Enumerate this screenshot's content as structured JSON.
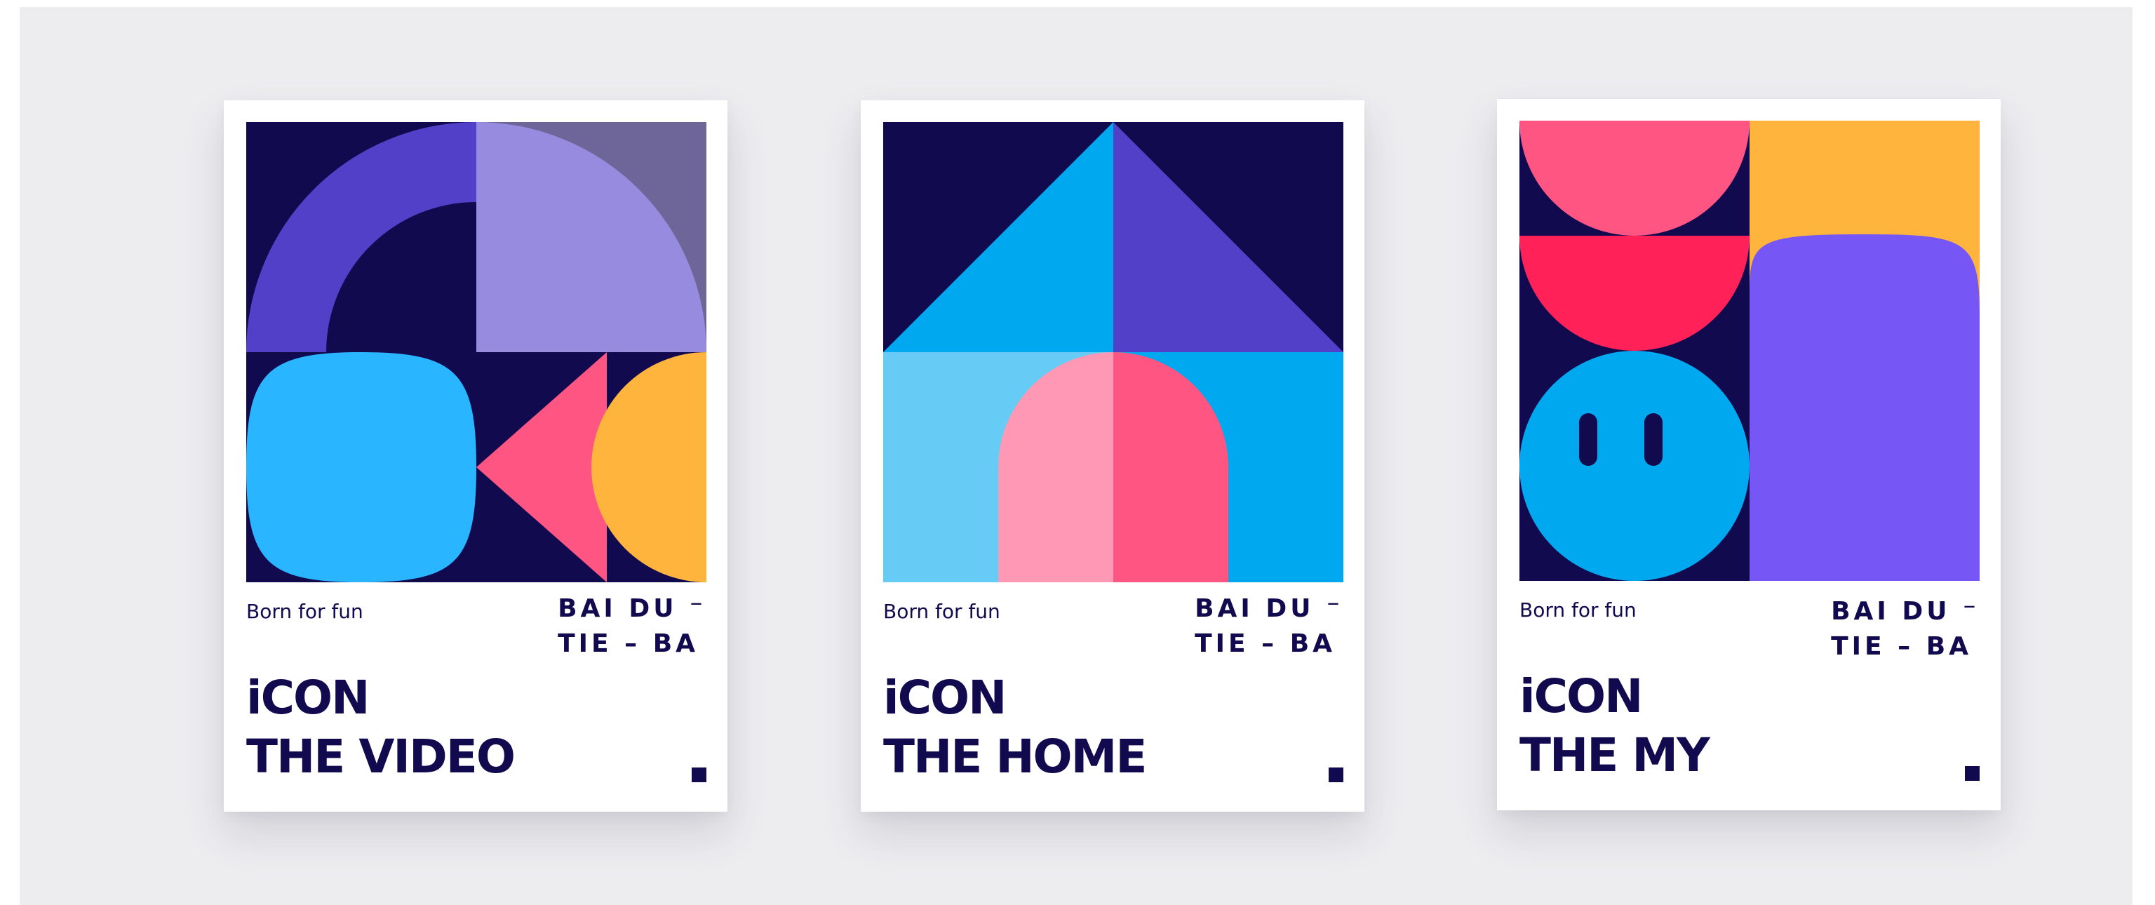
{
  "posters": [
    {
      "name": "video",
      "tagline": "Born for fun",
      "brand_line1": "BAI DU ⁻",
      "brand_line2": "TIE – BA",
      "title_line1": "iCON",
      "title_line2": "THE VIDEO"
    },
    {
      "name": "home",
      "tagline": "Born for fun",
      "brand_line1": "BAI DU ⁻",
      "brand_line2": "TIE – BA",
      "title_line1": "iCON",
      "title_line2": "THE HOME"
    },
    {
      "name": "my",
      "tagline": "Born for fun",
      "brand_line1": "BAI DU ⁻",
      "brand_line2": "TIE – BA",
      "title_line1": "iCON",
      "title_line2": "THE MY"
    }
  ],
  "colors": {
    "navy": "#120a4f",
    "purple": "#5340c8",
    "lavender": "#978be0",
    "slate_purple": "#6e6698",
    "sky_blue": "#29b5ff",
    "blue": "#00a9ef",
    "light_blue": "#66cbf5",
    "pink": "#ff5582",
    "light_pink": "#ff98b4",
    "red_pink": "#ff2158",
    "orange": "#ffb53d",
    "violet": "#7657f6"
  }
}
